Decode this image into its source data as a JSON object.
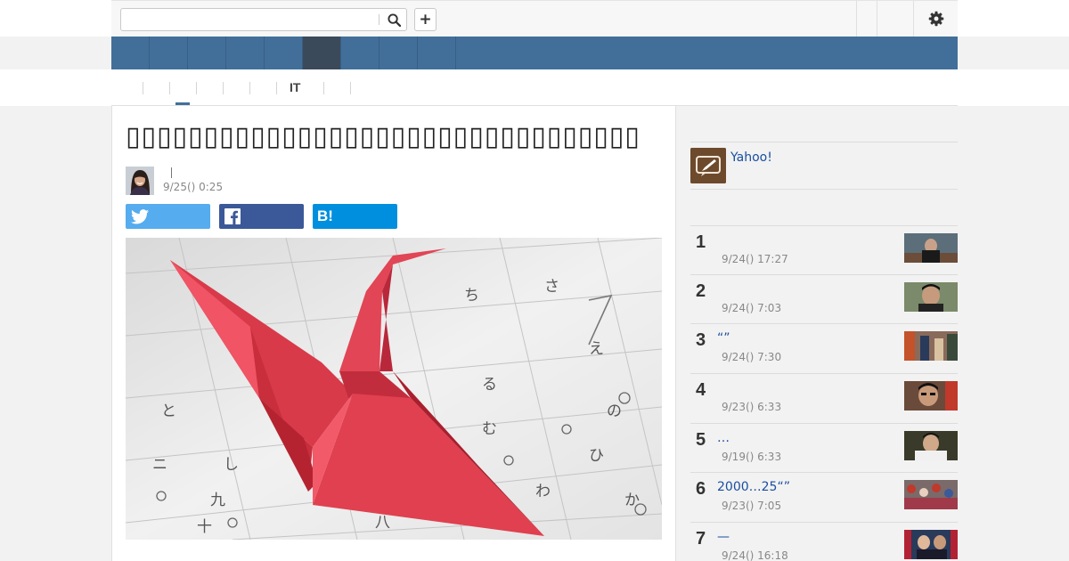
{
  "search": {
    "placeholder": ""
  },
  "header": {
    "add_label": "+",
    "nav_active_index": 5
  },
  "subnav": {
    "label_it": "IT"
  },
  "article": {
    "title": "▯▯▯▯▯▯▯▯▯▯▯▯▯▯▯▯▯▯▯▯▯▯▯▯▯▯▯▯▯▯▯▯▯",
    "date": "9/25() 0:25",
    "share": {
      "hatena_label": "B!"
    }
  },
  "sidebar": {
    "yahoo_label": "Yahoo!",
    "ranking": [
      {
        "rank": "1",
        "title": "",
        "date": "9/24() 17:27"
      },
      {
        "rank": "2",
        "title": "",
        "date": "9/24() 7:03"
      },
      {
        "rank": "3",
        "title": "“”",
        "date": "9/24() 7:30"
      },
      {
        "rank": "4",
        "title": "",
        "date": "9/23() 6:33"
      },
      {
        "rank": "5",
        "title": "…",
        "date": "9/19() 6:33"
      },
      {
        "rank": "6",
        "title": "2000…25“”",
        "date": "9/23() 7:05"
      },
      {
        "rank": "7",
        "title": "—",
        "date": "9/24() 16:18"
      }
    ]
  },
  "colors": {
    "nav_blue": "#426f99",
    "nav_active": "#3b4a5a",
    "link_blue": "#1a4fa0",
    "twitter": "#55acee",
    "facebook": "#3b5998",
    "hatena": "#008fde"
  }
}
